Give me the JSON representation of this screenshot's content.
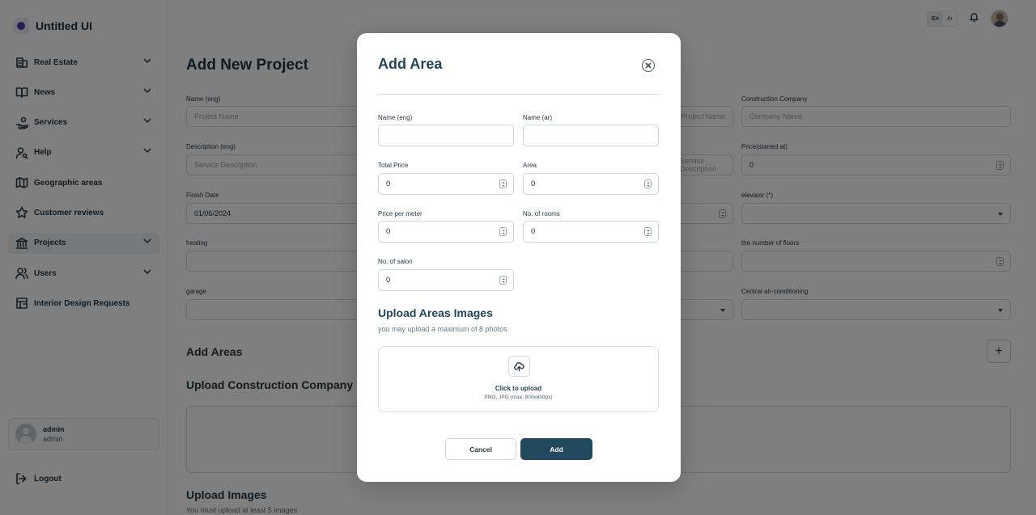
{
  "app": {
    "name": "Untitled UI"
  },
  "sidebar": {
    "items": [
      {
        "label": "Real Estate",
        "icon": "building-icon",
        "expandable": true
      },
      {
        "label": "News",
        "icon": "book-open-icon",
        "expandable": true
      },
      {
        "label": "Services",
        "icon": "hand-coins-icon",
        "expandable": true
      },
      {
        "label": "Help",
        "icon": "user-search-icon",
        "expandable": true
      },
      {
        "label": "Geographic areas",
        "icon": "map-icon",
        "expandable": false
      },
      {
        "label": "Customer reviews",
        "icon": "star-icon",
        "expandable": false
      },
      {
        "label": "Projects",
        "icon": "bank-icon",
        "expandable": true,
        "active": true
      },
      {
        "label": "Users",
        "icon": "users-icon",
        "expandable": true
      },
      {
        "label": "Interior Design Requests",
        "icon": "layout-icon",
        "expandable": false
      }
    ],
    "user": {
      "name": "admin",
      "role": "admin"
    },
    "logout_label": "Logout"
  },
  "topbar": {
    "lang_en": "En",
    "lang_ar": "Ar"
  },
  "page": {
    "title": "Add New Project",
    "fields": {
      "name_eng": {
        "label": "Name (eng)",
        "placeholder": "Project Name"
      },
      "name_ar_placeholder": "Project Name",
      "construction_company": {
        "label": "Construction Company",
        "placeholder": "Company Name"
      },
      "description_eng": {
        "label": "Description (eng)",
        "placeholder": "Service Description"
      },
      "description_ar_placeholder": "Service Description",
      "price_started": {
        "label": "Price(started at)",
        "value": "0"
      },
      "finish_date": {
        "label": "Finish Date",
        "value": "01/06/2024"
      },
      "elevator": {
        "label": "elevator (*)"
      },
      "heating": {
        "label": "heating"
      },
      "floors": {
        "label": "the number of floors"
      },
      "garage": {
        "label": "garage"
      },
      "central_ac": {
        "label": "Central air-conditioning"
      }
    },
    "add_areas_title": "Add Areas",
    "upload_company_title": "Upload Construction Company",
    "upload_images_title": "Upload Images",
    "upload_images_note": "You must upload at least 5 images"
  },
  "modal": {
    "title": "Add Area",
    "fields": {
      "name_eng": {
        "label": "Name (eng)",
        "value": ""
      },
      "name_ar": {
        "label": "Name (ar)",
        "value": ""
      },
      "total_price": {
        "label": "Total Price",
        "value": "0"
      },
      "area": {
        "label": "Area",
        "value": "0"
      },
      "price_per_meter": {
        "label": "Price per meter",
        "value": "0"
      },
      "rooms": {
        "label": "No. of rooms",
        "value": "0"
      },
      "salon": {
        "label": "No. of salon",
        "value": "0"
      }
    },
    "upload": {
      "title": "Upload Areas Images",
      "note": "you may upload a maximum of 8 photos",
      "click_label": "Click to upload",
      "hint": "PNG, JPG (max. 800x400px)"
    },
    "cancel_label": "Cancel",
    "add_label": "Add"
  }
}
